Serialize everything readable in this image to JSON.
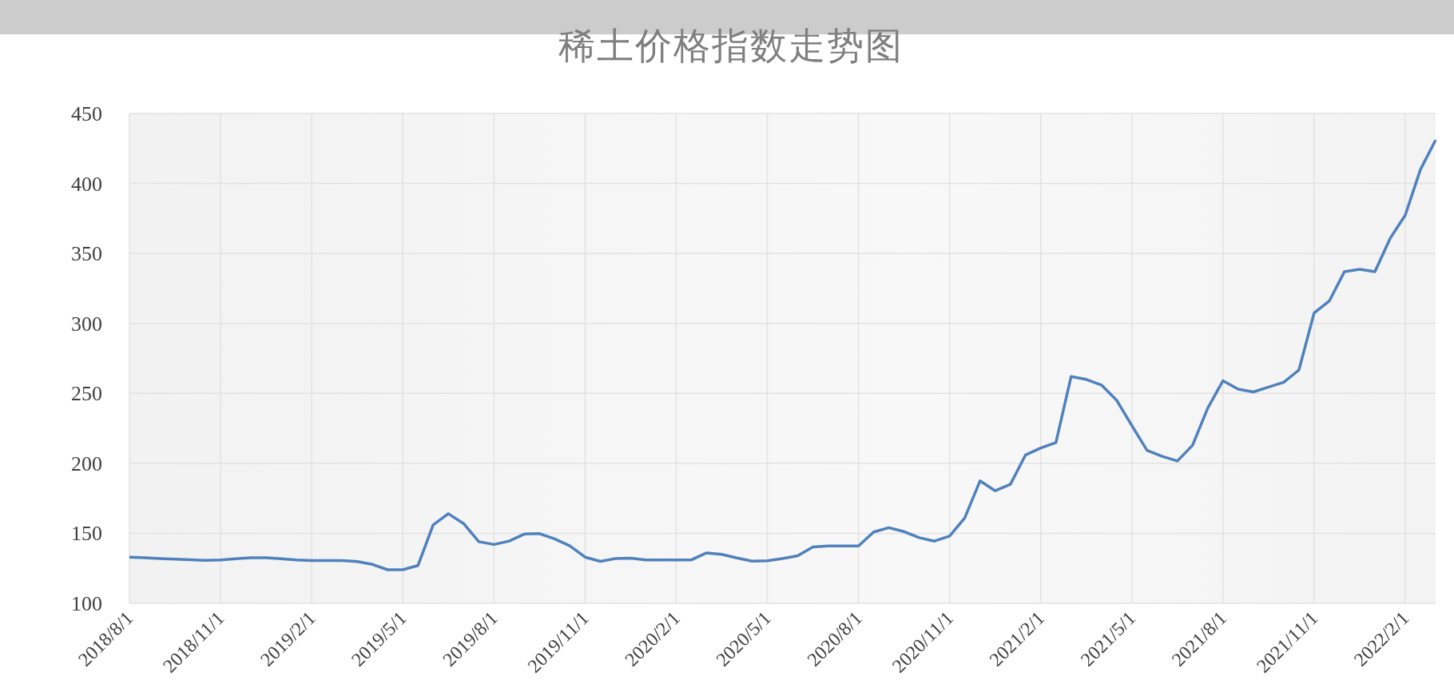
{
  "chart": {
    "title": "稀土价格指数走势图",
    "chart_data": {
      "type": "line",
      "grid": true,
      "ylim": [
        100,
        450
      ],
      "yticks": [
        100,
        150,
        200,
        250,
        300,
        350,
        400,
        450
      ],
      "categories": [
        "2018/8/1",
        null,
        null,
        null,
        null,
        null,
        "2018/11/1",
        null,
        null,
        null,
        null,
        null,
        "2019/2/1",
        null,
        null,
        null,
        null,
        null,
        "2019/5/1",
        null,
        null,
        null,
        null,
        null,
        "2019/8/1",
        null,
        null,
        null,
        null,
        null,
        "2019/11/1",
        null,
        null,
        null,
        null,
        null,
        "2020/2/1",
        null,
        null,
        null,
        null,
        null,
        "2020/5/1",
        null,
        null,
        null,
        null,
        null,
        "2020/8/1",
        null,
        null,
        null,
        null,
        null,
        "2020/11/1",
        null,
        null,
        null,
        null,
        null,
        "2021/2/1",
        null,
        null,
        null,
        null,
        null,
        "2021/5/1",
        null,
        null,
        null,
        null,
        null,
        "2021/8/1",
        null,
        null,
        null,
        null,
        null,
        "2021/11/1",
        null,
        null,
        null,
        null,
        null,
        "2022/2/1",
        null,
        null
      ],
      "series": [
        {
          "color": "#4f81bd",
          "values": [
            133,
            132.5,
            132,
            131.6,
            131.2,
            130.7,
            131,
            131.8,
            132.6,
            132.6,
            131.8,
            131,
            130.5,
            130.5,
            130.5,
            129.8,
            127.8,
            124,
            124,
            127,
            156,
            164,
            157,
            144,
            142,
            144.5,
            149.5,
            149.8,
            146,
            141,
            133,
            130,
            132,
            132.3,
            131,
            131,
            131,
            131,
            136,
            135,
            132.4,
            130.1,
            130.4,
            132,
            134,
            140.3,
            141,
            141,
            141,
            151,
            154,
            151.2,
            146.9,
            144.4,
            148,
            161,
            187.5,
            180.4,
            185,
            206,
            211,
            214.8,
            262,
            260,
            256,
            245,
            227,
            209.3,
            205,
            201.7,
            213,
            239.5,
            259,
            253,
            251,
            254.5,
            258,
            266.7,
            307.5,
            316,
            337,
            338.7,
            337,
            360.7,
            377.4,
            410,
            431
          ]
        }
      ]
    }
  }
}
